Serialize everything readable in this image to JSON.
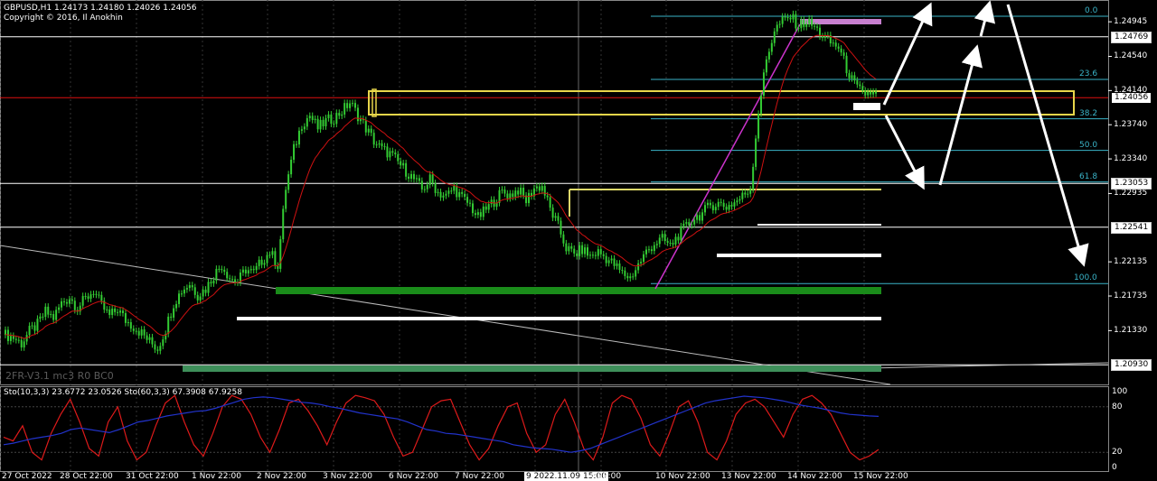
{
  "header": {
    "symbol_line": "GBPUSD,H1  1.24173 1.24180 1.24026 1.24056",
    "copyright": "Copyright © 2016, Il Anokhin"
  },
  "watermark": "2FR-V3.1 mc3 R0 BC0",
  "colors": {
    "background": "#000000",
    "candle": "#33cc33",
    "ma": "#cc1111",
    "fib": "#3ab4c8",
    "zone_yellow": "#e8d64a",
    "support_green": "#1a8c1a",
    "stoch_main": "#dd1a1a",
    "stoch_slow": "#2233cc",
    "magenta": "#cc33cc",
    "arrows": "#ffffff"
  },
  "chart_data": [
    {
      "type": "candlestick",
      "symbol": "GBPUSD",
      "timeframe": "H1",
      "ohlc_last": {
        "open": 1.24173,
        "high": 1.2418,
        "low": 1.24026,
        "close": 1.24056
      },
      "ylim": [
        1.207,
        1.252
      ],
      "y_ticks": [
        "1.24945",
        "1.24540",
        "1.24140",
        "1.23740",
        "1.23340",
        "1.22935",
        "1.22135",
        "1.21735",
        "1.21330"
      ],
      "price_levels": [
        "1.24769",
        "1.24056",
        "1.23053",
        "1.22541",
        "1.20930"
      ],
      "current_price": "1.24056",
      "x_ticks": [
        "27 Oct 2022",
        "28 Oct 22:00",
        "31 Oct 22:00",
        "1 Nov 22:00",
        "2 Nov 22:00",
        "3 Nov 22:00",
        "6 Nov 22:00",
        "7 Nov 22:00",
        "9 2022.11.09 15:00",
        "y 22:00",
        "10 Nov 22:00",
        "13 Nov 22:00",
        "14 Nov 22:00",
        "15 Nov 22:00"
      ],
      "fibonacci": [
        {
          "label": "0.0",
          "price": 1.2501
        },
        {
          "label": "23.6",
          "price": 1.2427
        },
        {
          "label": "38.2",
          "price": 1.2381
        },
        {
          "label": "50.0",
          "price": 1.2344
        },
        {
          "label": "61.8",
          "price": 1.2307
        },
        {
          "label": "100.0",
          "price": 1.2188
        }
      ],
      "close_path": [
        1.2128,
        1.2125,
        1.2118,
        1.2132,
        1.214,
        1.2155,
        1.2148,
        1.2165,
        1.2172,
        1.216,
        1.217,
        1.218,
        1.2162,
        1.215,
        1.2158,
        1.2145,
        1.2138,
        1.213,
        1.212,
        1.2112,
        1.2135,
        1.2165,
        1.218,
        1.2188,
        1.2175,
        1.2182,
        1.2198,
        1.221,
        1.2195,
        1.219,
        1.2205,
        1.22,
        1.2215,
        1.2225,
        1.221,
        1.23,
        1.2345,
        1.2375,
        1.2385,
        1.237,
        1.2378,
        1.2382,
        1.239,
        1.24,
        1.2385,
        1.237,
        1.2355,
        1.2345,
        1.234,
        1.233,
        1.232,
        1.231,
        1.2298,
        1.231,
        1.2295,
        1.229,
        1.23,
        1.2288,
        1.228,
        1.2265,
        1.2275,
        1.2285,
        1.2295,
        1.2292,
        1.2298,
        1.2285,
        1.23,
        1.2302,
        1.2275,
        1.2255,
        1.223,
        1.2222,
        1.2228,
        1.222,
        1.2225,
        1.2218,
        1.221,
        1.22,
        1.2195,
        1.221,
        1.2225,
        1.2235,
        1.224,
        1.2232,
        1.2245,
        1.2255,
        1.2265,
        1.227,
        1.228,
        1.2282,
        1.2278,
        1.2283,
        1.229,
        1.23,
        1.239,
        1.245,
        1.2485,
        1.2495,
        1.25,
        1.249,
        1.2495,
        1.2488,
        1.2478,
        1.247,
        1.2465,
        1.244,
        1.242,
        1.241,
        1.2412,
        1.2405
      ]
    },
    {
      "type": "line",
      "name": "Stochastic",
      "label": "Sto(10,3,3) 23.6772 23.0526  Sto(60,3,3) 67.3908 67.9258",
      "ylim": [
        0,
        100
      ],
      "y_ticks": [
        "100",
        "80",
        "20",
        "0"
      ],
      "series": [
        {
          "name": "Sto(10,3,3)",
          "values": [
            40,
            35,
            55,
            20,
            10,
            45,
            70,
            90,
            60,
            25,
            15,
            60,
            80,
            35,
            10,
            20,
            55,
            85,
            95,
            60,
            30,
            15,
            45,
            80,
            95,
            90,
            70,
            40,
            20,
            50,
            85,
            90,
            75,
            55,
            30,
            60,
            85,
            95,
            92,
            88,
            70,
            40,
            15,
            20,
            50,
            80,
            88,
            90,
            60,
            30,
            10,
            25,
            55,
            80,
            85,
            45,
            20,
            30,
            70,
            90,
            60,
            25,
            10,
            40,
            85,
            95,
            90,
            65,
            30,
            15,
            45,
            80,
            88,
            60,
            20,
            10,
            35,
            70,
            85,
            90,
            80,
            60,
            40,
            70,
            90,
            95,
            85,
            70,
            45,
            20,
            10,
            15,
            23.68
          ]
        },
        {
          "name": "Sto(60,3,3)",
          "values": [
            30,
            32,
            35,
            38,
            40,
            42,
            45,
            50,
            52,
            50,
            48,
            46,
            50,
            55,
            60,
            62,
            65,
            68,
            70,
            72,
            74,
            75,
            78,
            82,
            86,
            90,
            92,
            93,
            92,
            90,
            88,
            86,
            85,
            83,
            80,
            78,
            75,
            72,
            70,
            68,
            66,
            64,
            60,
            55,
            50,
            48,
            45,
            44,
            42,
            40,
            38,
            36,
            34,
            30,
            28,
            26,
            25,
            24,
            22,
            20,
            22,
            25,
            30,
            35,
            40,
            45,
            50,
            55,
            60,
            65,
            70,
            75,
            80,
            85,
            88,
            90,
            92,
            94,
            93,
            92,
            90,
            88,
            85,
            82,
            80,
            78,
            75,
            72,
            70,
            69,
            68,
            67.39
          ]
        }
      ]
    }
  ]
}
